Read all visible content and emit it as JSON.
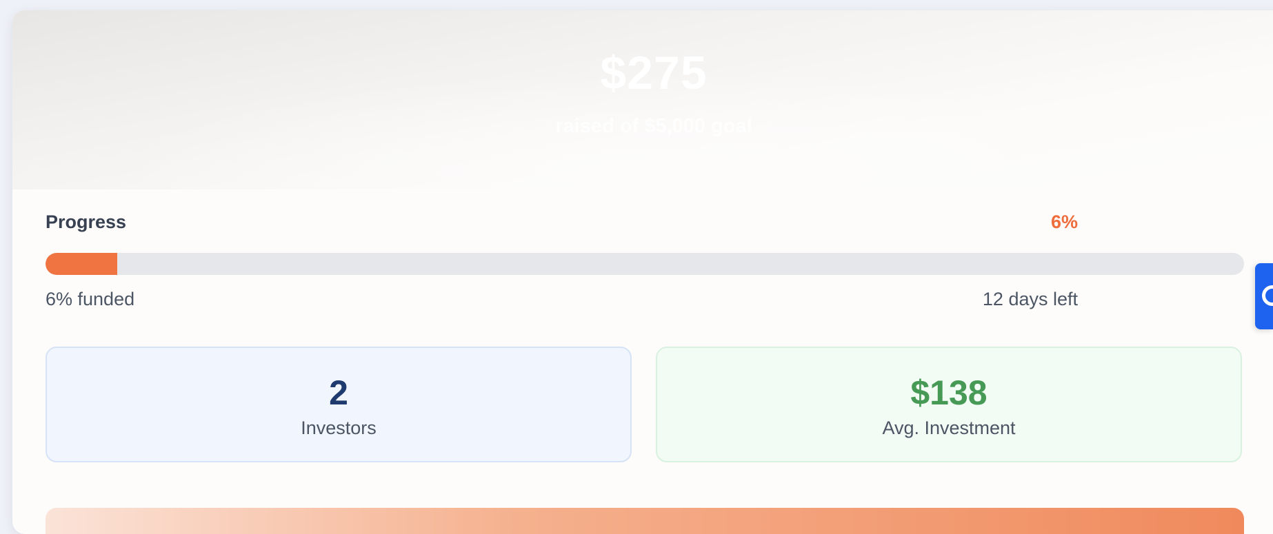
{
  "hero": {
    "amount": "$275",
    "subtitle": "raised of $5,000 goal"
  },
  "progress": {
    "label": "Progress",
    "percent_label": "6%",
    "percent_value": 6,
    "funded_text": "6% funded",
    "days_left_text": "12 days left"
  },
  "stats": {
    "investors": {
      "value": "2",
      "label": "Investors"
    },
    "avg_investment": {
      "value": "$138",
      "label": "Avg. Investment"
    }
  },
  "side_tab": {
    "icon": "chat-icon"
  },
  "colors": {
    "accent": "#ef6c3c",
    "investors_value": "#1e3a6e",
    "avg_value": "#479a55",
    "side_tab": "#1d63f0"
  }
}
